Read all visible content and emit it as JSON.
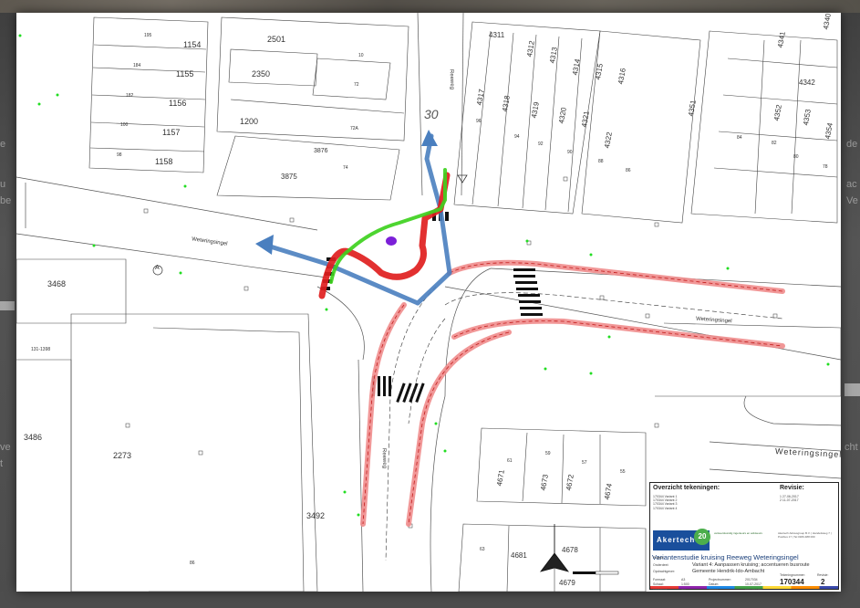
{
  "background_text": {
    "left_fragments": [
      "e",
      "u",
      "be",
      "ve",
      "t"
    ],
    "right_fragments": [
      "de",
      "ac",
      "Ve",
      "cht"
    ]
  },
  "map": {
    "street_names": {
      "reeweg_north": "Reeweg",
      "reeweg_south": "Reeweg",
      "weteringsingel_west": "Weteringsingel",
      "weteringsingel_east": "Weteringsingel",
      "weteringsingel_far_east": "Weteringsingel"
    },
    "speed_limit": "30",
    "parcel_numbers": [
      "2501",
      "2350",
      "1200",
      "3875",
      "3876",
      "1154",
      "1155",
      "1156",
      "1157",
      "1158",
      "3468",
      "2273",
      "3486",
      "3492",
      "4311",
      "4312",
      "4313",
      "4314",
      "4315",
      "4316",
      "4317",
      "4318",
      "4319",
      "4320",
      "4321",
      "4322",
      "4351",
      "4352",
      "4353",
      "4354",
      "4341",
      "4342",
      "4340",
      "4671",
      "4672",
      "4673",
      "4674",
      "4678",
      "4679",
      "4681",
      "131-1398"
    ],
    "house_numbers": [
      "195",
      "184",
      "182",
      "100",
      "98",
      "10",
      "72",
      "72A",
      "74",
      "96",
      "94",
      "92",
      "90",
      "88",
      "86",
      "84",
      "82",
      "80",
      "78",
      "61",
      "59",
      "57",
      "55",
      "63",
      "86"
    ],
    "marker_A": "A",
    "colors": {
      "bus_route_blue": "#4a7fbf",
      "variant_green": "#3ed11e",
      "variant_red": "#e01e1e",
      "curb_pink": "#f08c8c",
      "stop_purple": "#7b1fd8",
      "tree_green": "#22dd22"
    }
  },
  "title_block": {
    "overview_heading": "Overzicht tekeningen:",
    "overview_rows": [
      "170344  Variant 1",
      "170344  Variant 2",
      "170344  Variant 3",
      "170344  Variant 4"
    ],
    "revision_heading": "Revisie:",
    "revision_rows": [
      "1  27-06-2017",
      "2  11-07-2017"
    ],
    "logo_text": "Akertech",
    "logo_badge": "20",
    "company_text": "verkeerskundig ingenieurs en adviseurs",
    "address_text": "Akertech Adviesgroep B.V. | Handelsweg 7 | Postbus 17 | Tel 0180-488 000",
    "project_title": "Variantenstudie kruising Reeweg Weteringsingel",
    "subtitle_1": "Variant 4: Aanpassen kruising; accentueren busroute",
    "subtitle_2": "Gemeente Hendrik-Ido-Ambacht",
    "meta_labels": [
      "Project:",
      "Onderdeel:",
      "Opdrachtgever:",
      "Formaat:",
      "Schaal:",
      "Getekend:"
    ],
    "meta_values": [
      "A3",
      "1:500",
      "MJ"
    ],
    "meta_labels_right": [
      "Projectnummer:",
      "Datum:",
      "Status:"
    ],
    "meta_values_right": [
      "2017034",
      "10-07-2017",
      "DEFINITIEF"
    ],
    "drawing_number_label": "Tekeningnummer:",
    "drawing_number": "170344",
    "revision_label": "Revisie:",
    "revision_number": "2"
  }
}
